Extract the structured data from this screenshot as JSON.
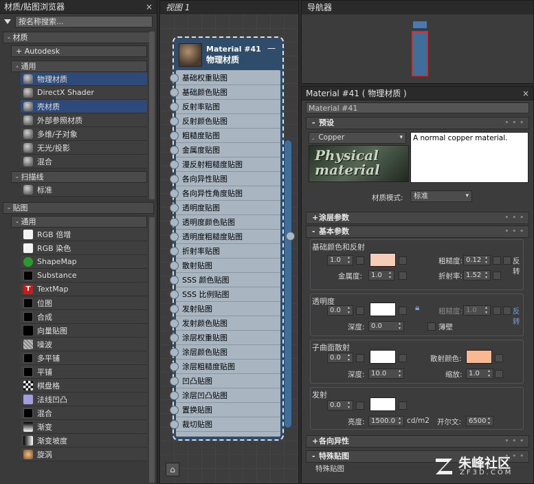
{
  "browser": {
    "title": "材质/贴图浏览器",
    "close": "×",
    "search_placeholder": "按名称搜索...",
    "sections": {
      "materials": "- 材质",
      "autodesk": "+ Autodesk",
      "general": "- 通用",
      "scanline": "- 扫描线",
      "maps": "- 贴图",
      "maps_general": "- 通用"
    },
    "general_items": [
      "物理材质",
      "DirectX Shader",
      "壳材质",
      "外部参照材质",
      "多维/子对象",
      "无光/投影",
      "混合"
    ],
    "scanline_items": [
      "标准"
    ],
    "map_items": [
      "RGB 倍增",
      "RGB 染色",
      "ShapeMap",
      "Substance",
      "TextMap",
      "位图",
      "合成",
      "向量贴图",
      "噪波",
      "多平铺",
      "平铺",
      "棋盘格",
      "法线凹凸",
      "混合",
      "渐变",
      "渐变坡度",
      "旋涡"
    ]
  },
  "view": {
    "title": "视图 1",
    "node_title": "Material #41",
    "node_subtitle": "物理材质",
    "node_minimize": "—",
    "slots": [
      "基础权重贴图",
      "基础颜色贴图",
      "反射率贴图",
      "反射颜色贴图",
      "粗糙度贴图",
      "金属度贴图",
      "漫反射粗糙度贴图",
      "各向异性贴图",
      "各向异性角度贴图",
      "透明度贴图",
      "透明度颜色贴图",
      "透明度粗糙度贴图",
      "折射率贴图",
      "散射贴图",
      "SSS 颜色贴图",
      "SSS 比例贴图",
      "发射贴图",
      "发射颜色贴图",
      "涂层权重贴图",
      "涂层颜色贴图",
      "涂层粗糙度贴图",
      "凹凸贴图",
      "涂层凹凸贴图",
      "置换贴图",
      "裁切贴图"
    ]
  },
  "navigator": {
    "title": "导航器",
    "close": "×"
  },
  "params": {
    "title": "Material #41  ( 物理材质 )",
    "close": "×",
    "material_name": "Material #41",
    "presets": {
      "label": "预设",
      "preset_value": "Copper",
      "description": "A normal copper material.",
      "preview_text": "Physical material",
      "mode_label": "材质模式:",
      "mode_value": "标准"
    },
    "coating": {
      "label": "涂层参数"
    },
    "basic": {
      "label": "基本参数",
      "base": {
        "title": "基础颜色和反射",
        "weight": "1.0",
        "color": "#f6cdb8",
        "roughness_label": "粗糙度:",
        "roughness": "0.12",
        "invert_label": "反转",
        "metalness_label": "金属度:",
        "metalness": "1.0",
        "ior_label": "折射率:",
        "ior": "1.52"
      },
      "transparency": {
        "title": "透明度",
        "weight": "0.0",
        "color": "#ffffff",
        "roughness_label": "粗糙度:",
        "roughness": "1.0",
        "invert_label": "反转",
        "depth_label": "深度:",
        "depth": "0.0",
        "thin_label": "薄壁"
      },
      "sss": {
        "title": "子曲面散射",
        "weight": "0.0",
        "color": "#ffffff",
        "scatter_label": "散射颜色:",
        "scatter_color": "#f8b891",
        "depth_label": "深度:",
        "depth": "10.0",
        "scale_label": "缩放:",
        "scale": "1.0"
      },
      "emission": {
        "title": "发射",
        "weight": "0.0",
        "color": "#ffffff",
        "luminance_label": "亮度:",
        "luminance": "1500.0",
        "unit": "cd/m2",
        "kelvin_label": "开尔文:",
        "kelvin": "6500"
      }
    },
    "aniso": {
      "label": "各向异性"
    },
    "special": {
      "label": "特殊贴图",
      "sub": "特殊贴图"
    }
  },
  "watermark": {
    "brand": "朱峰社区",
    "site": "ZF3D.COM"
  }
}
